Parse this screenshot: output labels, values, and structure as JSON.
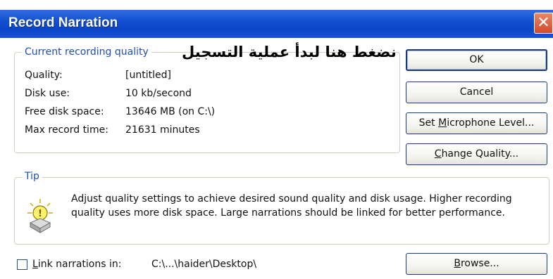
{
  "window": {
    "title": "Record Narration",
    "close_glyph": "✕"
  },
  "quality": {
    "legend": "Current recording quality",
    "rows": [
      {
        "label": "Quality:",
        "value": "[untitled]"
      },
      {
        "label": "Disk use:",
        "value": "10 kb/second"
      },
      {
        "label": "Free disk space:",
        "value": "13646 MB (on C:\\)"
      },
      {
        "label": "Max record time:",
        "value": "21631 minutes"
      }
    ],
    "annotation": "نضغط هنا لبدأ عملية التسجيل"
  },
  "buttons": {
    "ok": "OK",
    "cancel": "Cancel",
    "set_mic_pre": "Set ",
    "set_mic_mn": "M",
    "set_mic_post": "icrophone Level...",
    "change_quality_mn": "C",
    "change_quality_post": "hange Quality...",
    "browse_mn": "B",
    "browse_post": "rowse..."
  },
  "tip": {
    "legend": "Tip",
    "icon": "lightbulb-tip-icon",
    "text": "Adjust quality settings to achieve desired sound quality and disk usage. Higher recording quality uses more disk space. Large narrations should be linked for better performance."
  },
  "link": {
    "label_mn": "L",
    "label_post": "ink narrations in:",
    "path": "C:\\...\\haider\\Desktop\\",
    "checked": false
  },
  "colors": {
    "titlebar": "#0a46c8",
    "legend_text": "#1f4fb5",
    "close_button": "#d04a2a"
  }
}
